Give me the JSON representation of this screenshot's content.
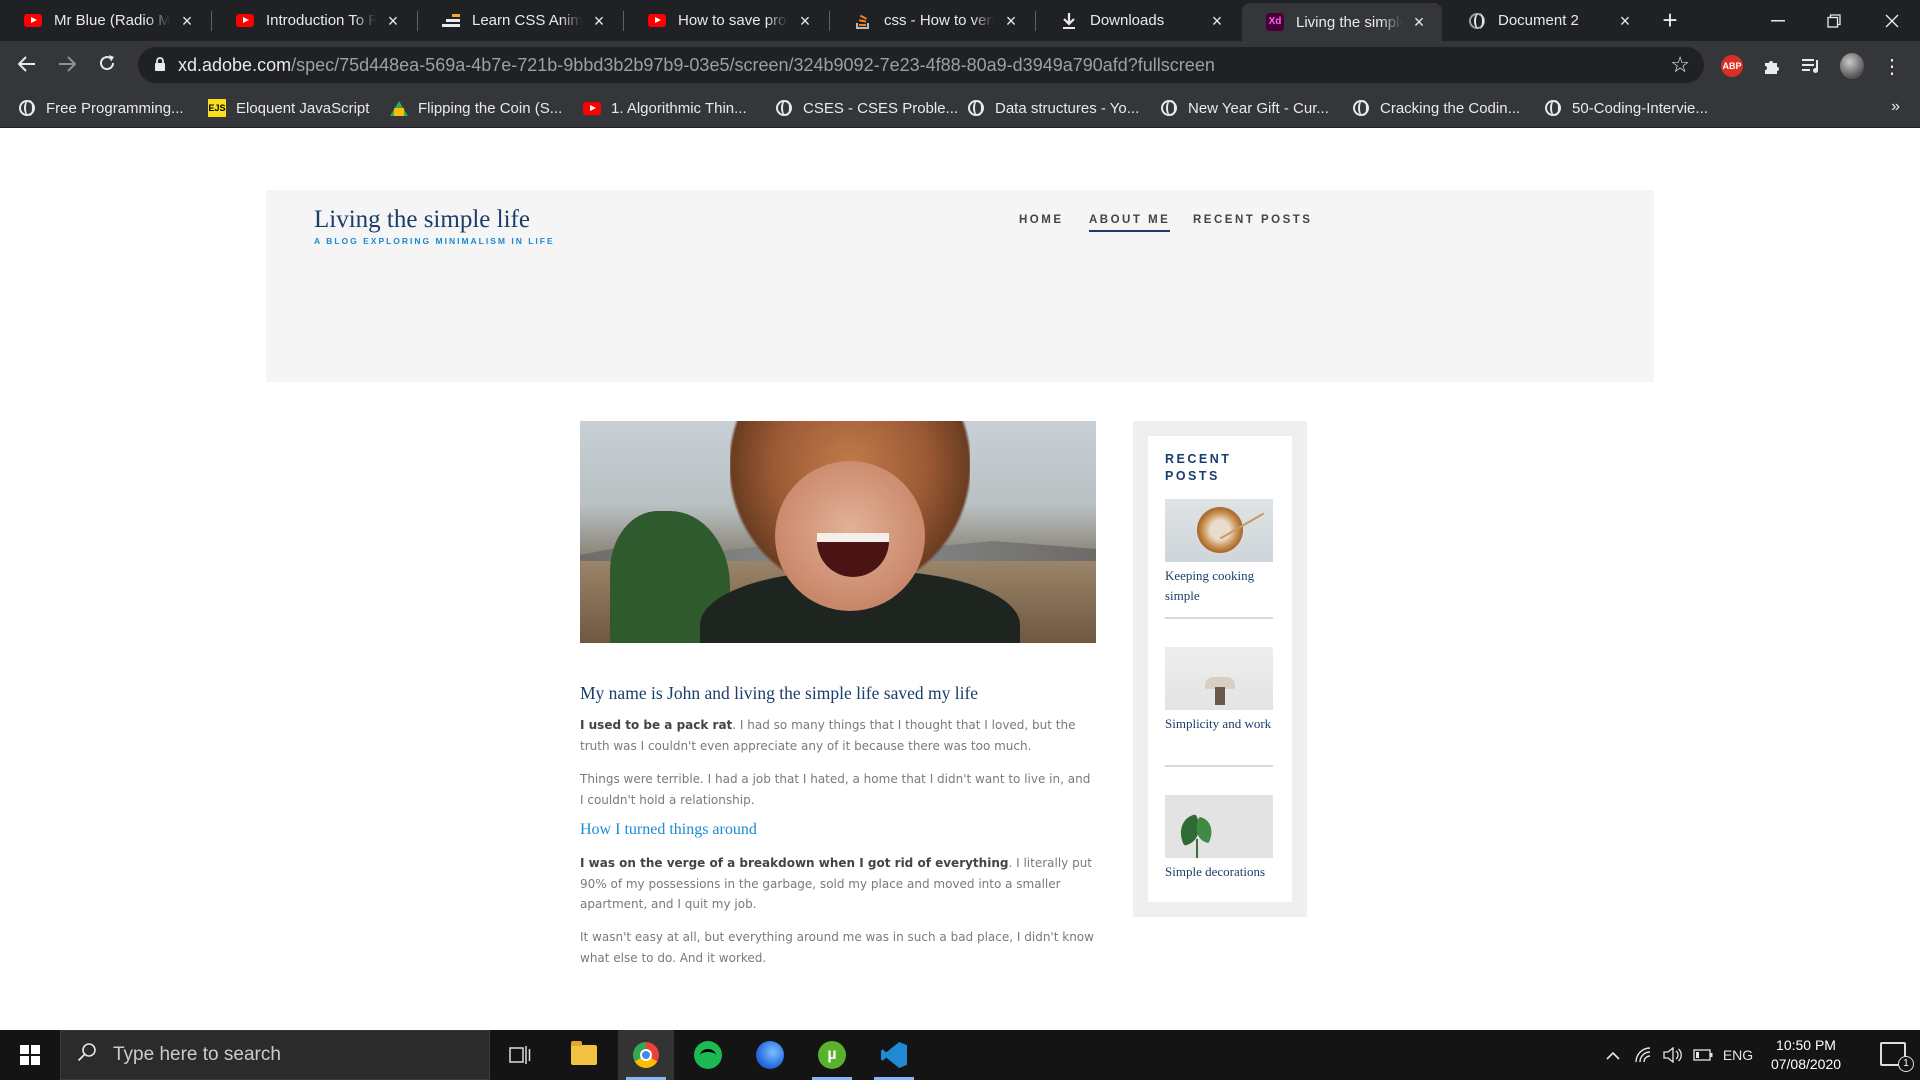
{
  "browser": {
    "tabs": [
      {
        "title": "Mr Blue (Radio Mix)",
        "icon": "youtube-icon",
        "active": false
      },
      {
        "title": "Introduction To React",
        "icon": "youtube-icon",
        "active": false
      },
      {
        "title": "Learn CSS Animation",
        "icon": "css-tricks-icon",
        "active": false
      },
      {
        "title": "How to save protected",
        "icon": "youtube-icon",
        "active": false
      },
      {
        "title": "css - How to vertically",
        "icon": "stackoverflow-icon",
        "active": false
      },
      {
        "title": "Downloads",
        "icon": "download-icon",
        "active": false
      },
      {
        "title": "Living the simple life",
        "icon": "adobe-xd-icon",
        "active": true
      },
      {
        "title": "Document 2",
        "icon": "globe-icon",
        "active": false
      }
    ],
    "url_host": "xd.adobe.com",
    "url_path": "/spec/75d448ea-569a-4b7e-721b-9bbd3b2b97b9-03e5/screen/324b9092-7e23-4f88-80a9-d3949a790afd?fullscreen",
    "abp_label": "ABP",
    "bookmarks": [
      {
        "label": "Free Programming...",
        "icon": "globe-icon"
      },
      {
        "label": "Eloquent JavaScript",
        "icon": "ejs-icon",
        "badge": "EJS"
      },
      {
        "label": "Flipping the Coin (S...",
        "icon": "google-drive-icon"
      },
      {
        "label": "1. Algorithmic Thin...",
        "icon": "youtube-icon"
      },
      {
        "label": "CSES - CSES Proble...",
        "icon": "globe-icon"
      },
      {
        "label": "Data structures - Yo...",
        "icon": "globe-icon"
      },
      {
        "label": "New Year Gift - Cur...",
        "icon": "globe-icon"
      },
      {
        "label": "Cracking the Codin...",
        "icon": "globe-icon"
      },
      {
        "label": "50-Coding-Intervie...",
        "icon": "globe-icon"
      }
    ],
    "more_bookmarks": "»"
  },
  "site": {
    "title": "Living the simple life",
    "tagline": "A BLOG EXPLORING MINIMALISM IN LIFE",
    "nav": [
      {
        "label": "HOME",
        "current": false
      },
      {
        "label": "ABOUT ME",
        "current": true
      },
      {
        "label": "RECENT POSTS",
        "current": false
      }
    ]
  },
  "article": {
    "title": "My name is John and living the simple life saved my life",
    "p1_bold": "I used to be a pack rat",
    "p1_rest": ". I had so many things that I thought that I loved, but the truth was I couldn't even appreciate any of it because there was too much.",
    "p2": "Things were terrible. I had a job that I hated, a home that I didn't want to live in, and I couldn't hold a relationship.",
    "subheading": "How I turned things around",
    "p3_bold": "I was on the verge of a breakdown when I got rid of everything",
    "p3_rest": ". I literally put 90% of my possessions in the garbage, sold my place and moved into a smaller apartment, and I quit my job.",
    "p4": "It wasn't easy at all, but everything around me was in such a bad place, I didn't know what else to do. And it worked."
  },
  "sidebar": {
    "title": "RECENT POSTS",
    "posts": [
      {
        "label": "Keeping cooking simple"
      },
      {
        "label": "Simplicity and work"
      },
      {
        "label": "Simple decorations"
      }
    ]
  },
  "taskbar": {
    "search_placeholder": "Type here to search",
    "apps": [
      "task-view-icon",
      "file-explorer-icon",
      "chrome-icon",
      "spotify-icon",
      "firefox-icon",
      "utorrent-icon",
      "vscode-icon"
    ],
    "utorrent_glyph": "µ",
    "language": "ENG",
    "time": "10:50 PM",
    "date": "07/08/2020",
    "notification_count": "1"
  }
}
